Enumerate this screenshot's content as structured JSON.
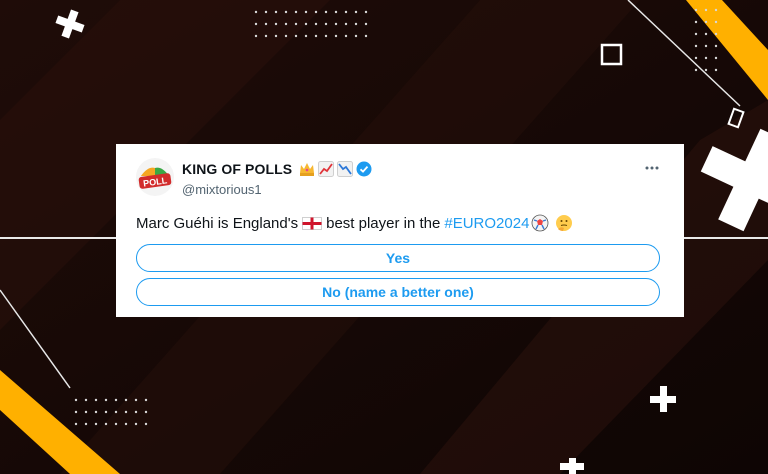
{
  "colors": {
    "background": "#140806",
    "accent_yellow": "#ffb000",
    "link_blue": "#1d9bf0"
  },
  "tweet": {
    "display_name": "KING OF POLLS",
    "handle": "@mixtorious1",
    "avatar_label": "POLL",
    "name_emojis": [
      "crown-emoji",
      "chart-increasing-emoji",
      "chart-decreasing-emoji"
    ],
    "verified_icon": "verified-badge-icon",
    "more_icon": "more-options-icon",
    "text_before_flag": "Marc Guéhi is England's",
    "text_after_flag": "best player in the",
    "hashtag": "#EURO2024",
    "trailing_emojis": [
      "football-emoji",
      "thinking-face-emoji"
    ],
    "flag_icon": "england-flag-icon",
    "poll_options": [
      "Yes",
      "No (name a better one)"
    ]
  }
}
